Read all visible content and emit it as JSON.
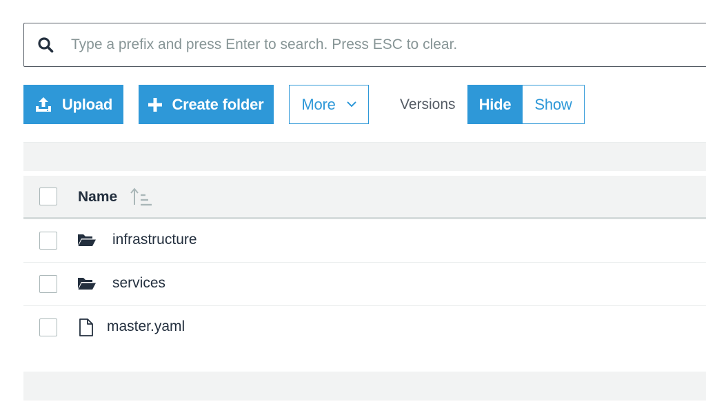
{
  "search": {
    "placeholder": "Type a prefix and press Enter to search. Press ESC to clear.",
    "value": ""
  },
  "toolbar": {
    "upload_label": "Upload",
    "create_folder_label": "Create folder",
    "more_label": "More",
    "versions_label": "Versions",
    "hide_label": "Hide",
    "show_label": "Show",
    "versions_selected": "Hide"
  },
  "table": {
    "columns": [
      "Name"
    ],
    "sort": "ascending",
    "rows": [
      {
        "name": "infrastructure",
        "type": "folder",
        "icon": "folder-icon"
      },
      {
        "name": "services",
        "type": "folder",
        "icon": "folder-icon"
      },
      {
        "name": "master.yaml",
        "type": "file",
        "icon": "file-icon"
      }
    ]
  },
  "colors": {
    "accent": "#2e98d8",
    "text": "#232f3e",
    "band": "#f2f3f3"
  }
}
